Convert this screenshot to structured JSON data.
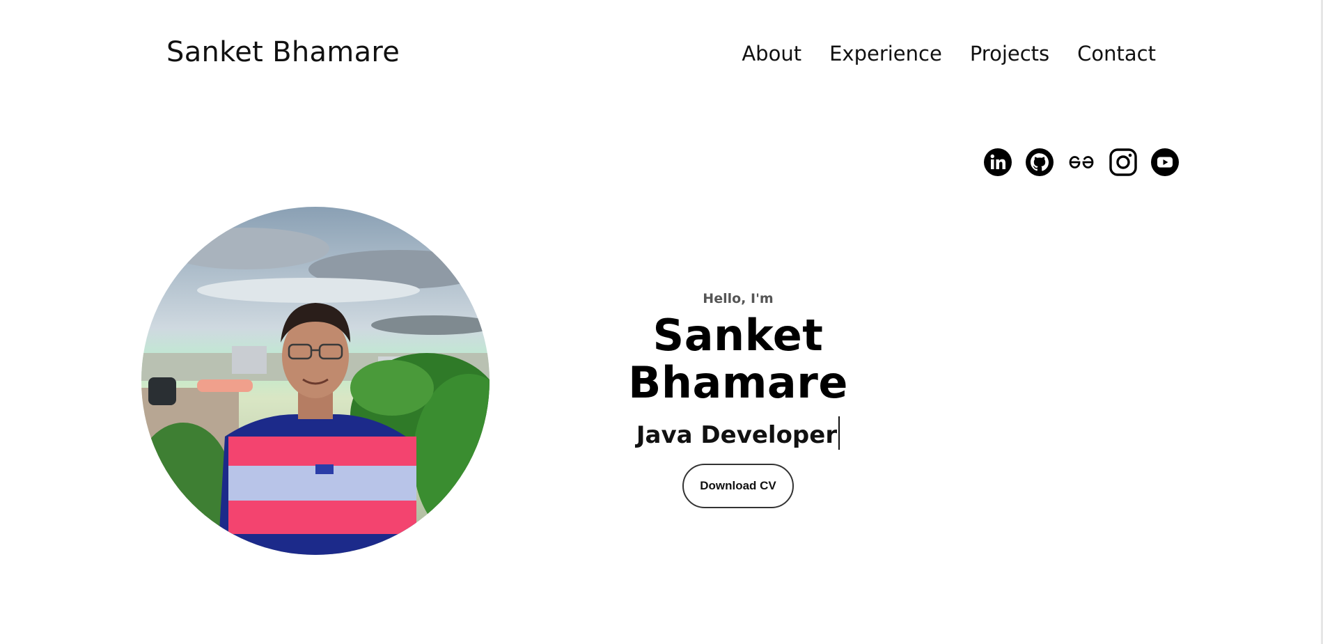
{
  "header": {
    "logo": "Sanket Bhamare",
    "nav": [
      {
        "label": "About"
      },
      {
        "label": "Experience"
      },
      {
        "label": "Projects"
      },
      {
        "label": "Contact"
      }
    ]
  },
  "socials": [
    {
      "icon": "linkedin-icon"
    },
    {
      "icon": "github-icon"
    },
    {
      "icon": "geeksforgeeks-icon"
    },
    {
      "icon": "instagram-icon"
    },
    {
      "icon": "youtube-icon"
    }
  ],
  "hero": {
    "greeting": "Hello, I'm",
    "name": "Sanket Bhamare",
    "role": "Java Developer",
    "download_label": "Download CV"
  }
}
